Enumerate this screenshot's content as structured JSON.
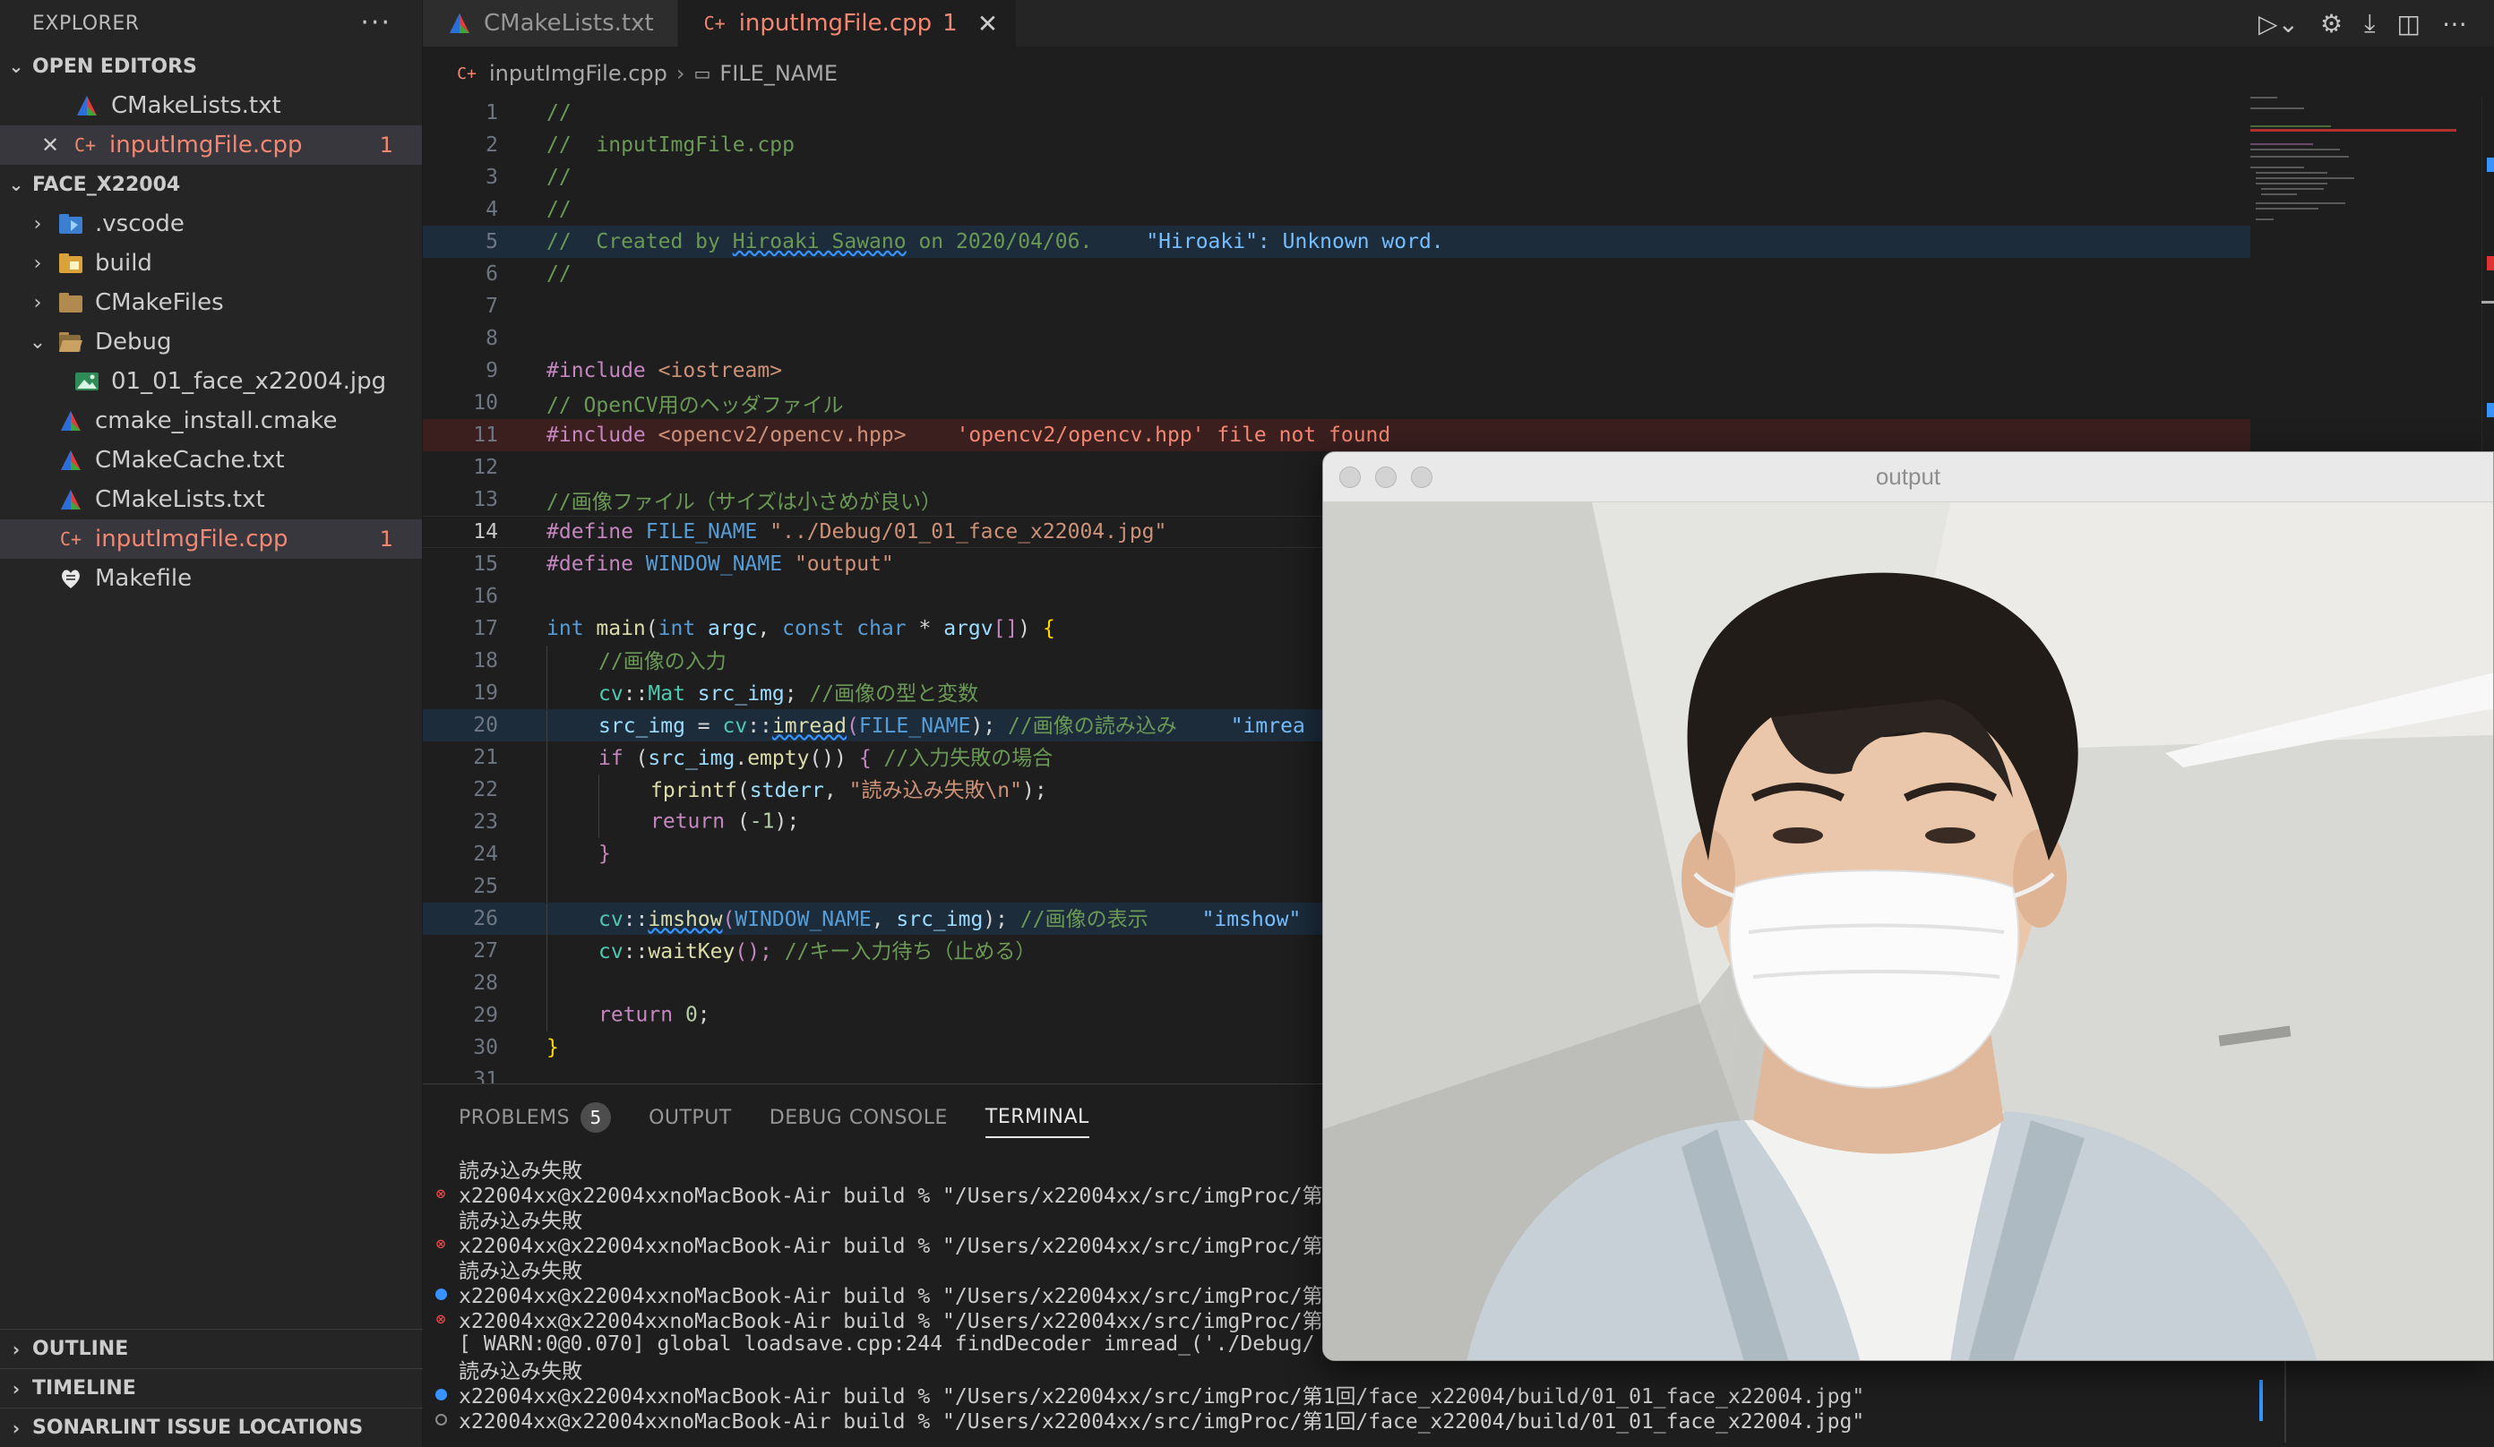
{
  "sidebar": {
    "title": "EXPLORER",
    "more": "···",
    "open_editors": {
      "header": "OPEN EDITORS",
      "items": [
        {
          "name": "CMakeLists.txt"
        },
        {
          "name": "inputImgFile.cpp",
          "problems": "1"
        }
      ]
    },
    "project": {
      "header": "FACE_X22004",
      "items": [
        {
          "name": ".vscode"
        },
        {
          "name": "build"
        },
        {
          "name": "CMakeFiles"
        },
        {
          "name": "Debug"
        },
        {
          "name": "01_01_face_x22004.jpg"
        },
        {
          "name": "cmake_install.cmake"
        },
        {
          "name": "CMakeCache.txt"
        },
        {
          "name": "CMakeLists.txt"
        },
        {
          "name": "inputImgFile.cpp",
          "problems": "1"
        },
        {
          "name": "Makefile"
        }
      ]
    },
    "bottom": {
      "outline": "OUTLINE",
      "timeline": "TIMELINE",
      "sonarlint": "SONARLINT ISSUE LOCATIONS"
    }
  },
  "tabs": [
    {
      "label": "CMakeLists.txt"
    },
    {
      "label": "inputImgFile.cpp",
      "problems": "1",
      "close": "✕"
    }
  ],
  "breadcrumb": {
    "file": "inputImgFile.cpp",
    "symbol": "FILE_NAME"
  },
  "code": {
    "line_numbers": [
      "1",
      "2",
      "3",
      "4",
      "5",
      "6",
      "7",
      "8",
      "9",
      "10",
      "11",
      "12",
      "13",
      "14",
      "15",
      "16",
      "17",
      "18",
      "19",
      "20",
      "21",
      "22",
      "23",
      "24",
      "25",
      "26",
      "27",
      "28",
      "29",
      "30",
      "31"
    ],
    "l1": "//",
    "l2": "//  inputImgFile.cpp",
    "l3": "//",
    "l4": "//",
    "l5_a": "//  Created by ",
    "l5_b": "Hiroaki Sawano",
    "l5_c": " on 2020/04/06.",
    "l5_hint": "\"Hiroaki\": Unknown word.",
    "l6": "//",
    "l9_a": "#include",
    "l9_b": " <iostream>",
    "l10": "// OpenCV用のヘッダファイル",
    "l11_a": "#include",
    "l11_b": " <opencv2/opencv.hpp>",
    "l11_hint": "'opencv2/opencv.hpp' file not found",
    "l13": "//画像ファイル（サイズは小さめが良い）",
    "l14_a": "#define",
    "l14_b": " FILE_NAME ",
    "l14_c": "\"../Debug/01_01_face_x22004.jpg\"",
    "l15_a": "#define",
    "l15_b": " WINDOW_NAME ",
    "l15_c": "\"output\"",
    "l17_int": "int",
    "l17_main": " main",
    "l17_p1": "(",
    "l17_int2": "int",
    "l17_argc": " argc",
    "l17_comma": ", ",
    "l17_const": "const char",
    "l17_star": " * ",
    "l17_argv": "argv",
    "l17_br": "[]",
    "l17_close": ") ",
    "l17_brace": "{",
    "l18": "//画像の入力",
    "l19_ns": "cv",
    "l19_sep": "::",
    "l19_type": "Mat",
    "l19_var": " src_img",
    "l19_semi": "; ",
    "l19_cm": "//画像の型と変数",
    "l20_var": "src_img",
    "l20_eq": " = ",
    "l20_ns": "cv",
    "l20_sep": "::",
    "l20_fn": "imread",
    "l20_p": "(",
    "l20_arg": "FILE_NAME",
    "l20_pc": ");",
    "l20_cm": " //画像の読み込み",
    "l20_hint": "\"imrea",
    "l21_if": "if",
    "l21_a": " (",
    "l21_var": "src_img",
    "l21_dot": ".",
    "l21_fn": "empty",
    "l21_b": "()) ",
    "l21_brace": "{",
    "l21_cm": " //入力失敗の場合",
    "l22_fn": "fprintf",
    "l22_a": "(",
    "l22_var": "stderr",
    "l22_c": ", ",
    "l22_str": "\"読み込み失敗\\n\"",
    "l22_e": ");",
    "l23_kw": "return",
    "l23_a": " (",
    "l23_num": "-1",
    "l23_b": ");",
    "l24": "}",
    "l26_ns": "cv",
    "l26_sep": "::",
    "l26_fn": "imshow",
    "l26_p": "(",
    "l26_arg1": "WINDOW_NAME",
    "l26_c": ", ",
    "l26_arg2": "src_img",
    "l26_e": ");",
    "l26_cm": " //画像の表示",
    "l26_hint": "\"imshow\"",
    "l27_ns": "cv",
    "l27_sep": "::",
    "l27_fn": "waitKey",
    "l27_p": "();",
    "l27_cm": " //キー入力待ち（止める）",
    "l29_kw": "return",
    "l29_num": " 0",
    "l29_semi": ";",
    "l30": "}"
  },
  "panel": {
    "tabs": [
      {
        "label": "PROBLEMS",
        "badge": "5"
      },
      {
        "label": "OUTPUT"
      },
      {
        "label": "DEBUG CONSOLE"
      },
      {
        "label": "TERMINAL"
      }
    ],
    "terminal_lines": [
      "読み込み失敗",
      "x22004xx@x22004xxnoMacBook-Air build % \"/Users/x22004xx/src/imgProc/第",
      "読み込み失敗",
      "x22004xx@x22004xxnoMacBook-Air build % \"/Users/x22004xx/src/imgProc/第",
      "読み込み失敗",
      "x22004xx@x22004xxnoMacBook-Air build % \"/Users/x22004xx/src/imgProc/第",
      "x22004xx@x22004xxnoMacBook-Air build % \"/Users/x22004xx/src/imgProc/第",
      "[ WARN:0@0.070] global loadsave.cpp:244 findDecoder imread_('./Debug/",
      "読み込み失敗",
      "x22004xx@x22004xxnoMacBook-Air build % \"/Users/x22004xx/src/imgProc/第1回/face_x22004/build/01_01_face_x22004.jpg\"",
      "x22004xx@x22004xxnoMacBook-Air build % \"/Users/x22004xx/src/imgProc/第1回/face_x22004/build/01_01_face_x22004.jpg\""
    ]
  },
  "output_window": {
    "title": "output"
  },
  "colors": {
    "accent_blue": "#3794ff",
    "error_red": "#f48771",
    "sidebar_bg": "#252526",
    "editor_bg": "#1e1e1e"
  }
}
